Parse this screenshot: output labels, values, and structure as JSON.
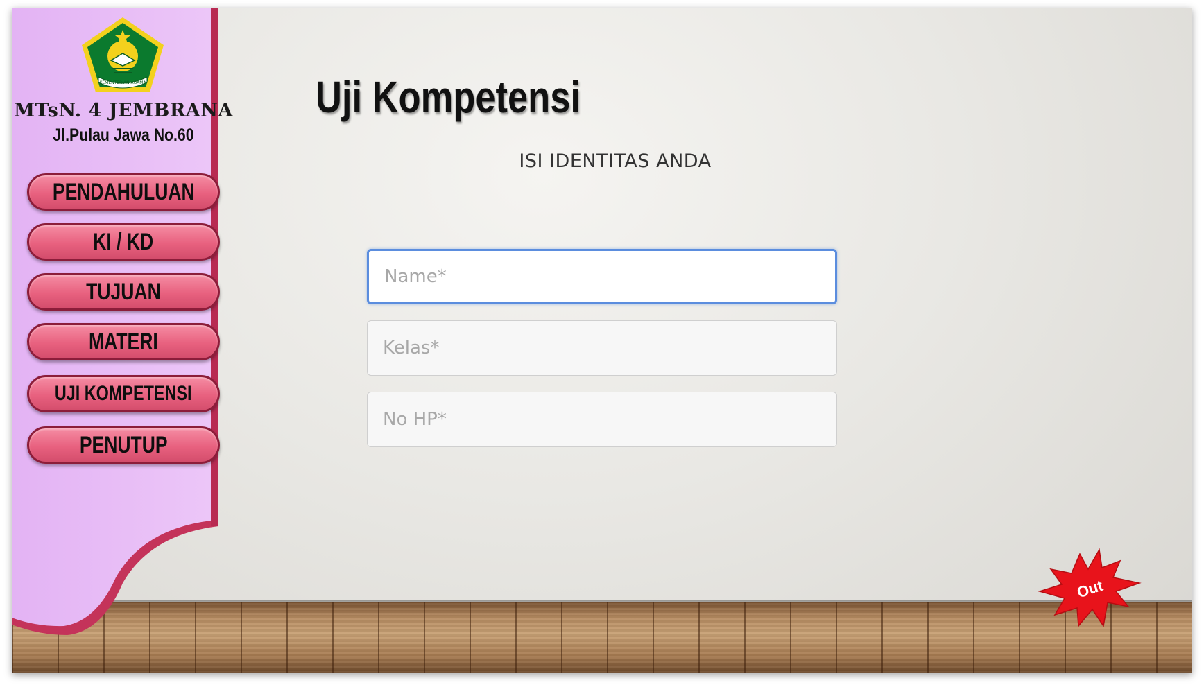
{
  "sidebar": {
    "school_name": "MTsN. 4 JEMBRANA",
    "school_address": "Jl.Pulau  Jawa No.60",
    "logo_text": "KEMENTERIAN AGAMA",
    "colors": {
      "panel": "#e6b8f5",
      "border": "#c4335a",
      "button": "#e8617f"
    },
    "nav": [
      {
        "label": "PENDAHULUAN"
      },
      {
        "label": "KI / KD"
      },
      {
        "label": "TUJUAN"
      },
      {
        "label": "MATERI"
      },
      {
        "label": "UJI KOMPETENSI"
      },
      {
        "label": "PENUTUP"
      }
    ]
  },
  "main": {
    "title": "Uji Kompetensi",
    "subtitle": "ISI IDENTITAS ANDA",
    "form": {
      "name_placeholder": "Name*",
      "kelas_placeholder": "Kelas*",
      "hp_placeholder": "No HP*",
      "name_value": "",
      "kelas_value": "",
      "hp_value": "",
      "focused_field": "name",
      "focus_color": "#5b8dde"
    }
  },
  "exit_button": {
    "label": "Out",
    "color": "#e8131b",
    "icon": "starburst-icon"
  }
}
